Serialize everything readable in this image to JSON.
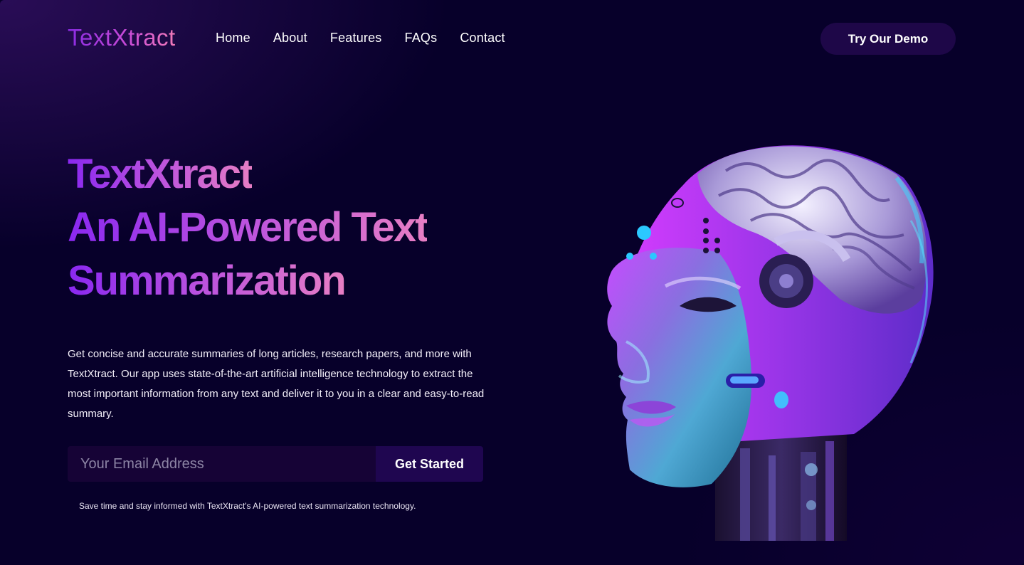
{
  "brand": {
    "logo_text": "TextXtract"
  },
  "nav": {
    "items": [
      {
        "label": "Home"
      },
      {
        "label": "About"
      },
      {
        "label": "Features"
      },
      {
        "label": "FAQs"
      },
      {
        "label": "Contact"
      }
    ],
    "cta_label": "Try Our Demo"
  },
  "hero": {
    "title_line1": "TextXtract",
    "title_line2": "An AI-Powered Text",
    "title_line3": "Summarization",
    "description": "Get concise and accurate summaries of long articles, research papers, and more with TextXtract. Our app uses state-of-the-art artificial intelligence technology to extract the most important information from any text and deliver it to you in a clear and easy-to-read summary.",
    "email_placeholder": "Your Email Address",
    "email_value": "",
    "submit_label": "Get Started",
    "note": "Save time and stay informed with TextXtract's AI-powered text summarization technology."
  },
  "colors": {
    "background": "#07002a",
    "button_bg": "#1f0650",
    "gradient_start": "#8a28f0",
    "gradient_end": "#e77ec4"
  }
}
